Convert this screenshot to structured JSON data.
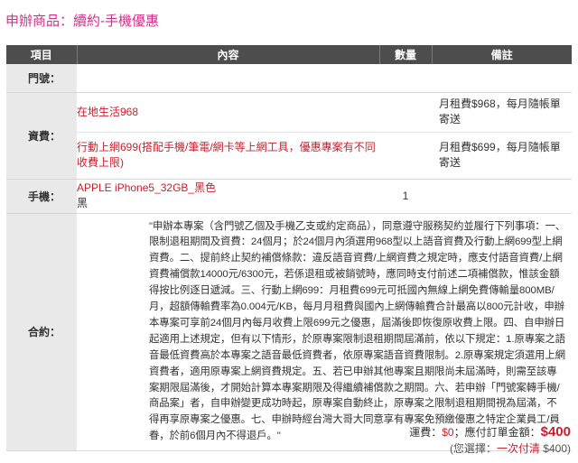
{
  "page_title": "申辦商品：續約-手機優惠",
  "table": {
    "headers": {
      "item": "項目",
      "content": "內容",
      "qty": "數量",
      "note": "備註"
    },
    "door_no": {
      "label": "門號："
    },
    "tariff": {
      "label": "資費：",
      "plan1": {
        "name": "在地生活968",
        "note": "月租費$968，每月隨帳單寄送"
      },
      "plan2": {
        "name_line1": "行動上網699(搭配手機/筆電/網卡等上網工具，優惠專案有不同",
        "name_line2": "收費上限)",
        "note": "月租費$699，每月隨帳單寄送"
      }
    },
    "phone": {
      "label": "手機：",
      "model": "APPLE iPhone5_32GB_黑色",
      "color": "黑",
      "qty": "1"
    },
    "contract": {
      "label": "合約：",
      "text": "\"申辦本專案（含門號乙個及手機乙支或約定商品），同意遵守服務契約並履行下列事項：一、限制退租期間及資費：24個月；於24個月內須選用968型以上語音資費及行動上網699型上網資費。二、提前終止契約補償條款：違反語音資費/上網資費之規定時，應支付語音資費/上網資費補償款14000元/6300元，若係退租或被銷號時，應同時支付前述二項補償款，惟該金額得按比例逐日遞減。三、行動上網699：月租費699元可抵國內無線上網免費傳輸量800MB/月，超額傳輸費率為0.004元/KB，每月月租費與國內上網傳輸費合計最高以800元計收，申辦本專案可享前24個月內每月收費上限699元之優惠，屆滿後即恢復原收費上限。四、自申辦日起適用上述規定，但有以下情形，於原專案限制退租期間屆滿前，依以下規定：1.原專案之語音最低資費高於本專案之語音最低資費者，依原專案語音資費限制。2.原專案規定須選用上網資費者，適用原專案上網資費規定。五、若已申辦其他專案且期限尚未屆滿時，則需至該專案期限屆滿後，才開始計算本專案期限及得繼續補償款之期間。六、若申辦「門號案轉手機/商品案」者，自申辦變更成功時起，原專案自動終止，原專案之限制退租期間視為屆滿，不得再享原專案之優惠。七、申辦時經台灣大哥大同意享有專案免預繳優惠之特定企業員工/員眷，於前6個月內不得退戶。\""
    }
  },
  "totals": {
    "shipping_label": "運費：",
    "shipping_value": "$0",
    "separator": "；",
    "order_total_label": "應付訂單金額：",
    "order_total_value": "$400",
    "payment_prefix": "(您選擇：",
    "payment_method": "一次付清",
    "payment_amount": "$400)"
  }
}
